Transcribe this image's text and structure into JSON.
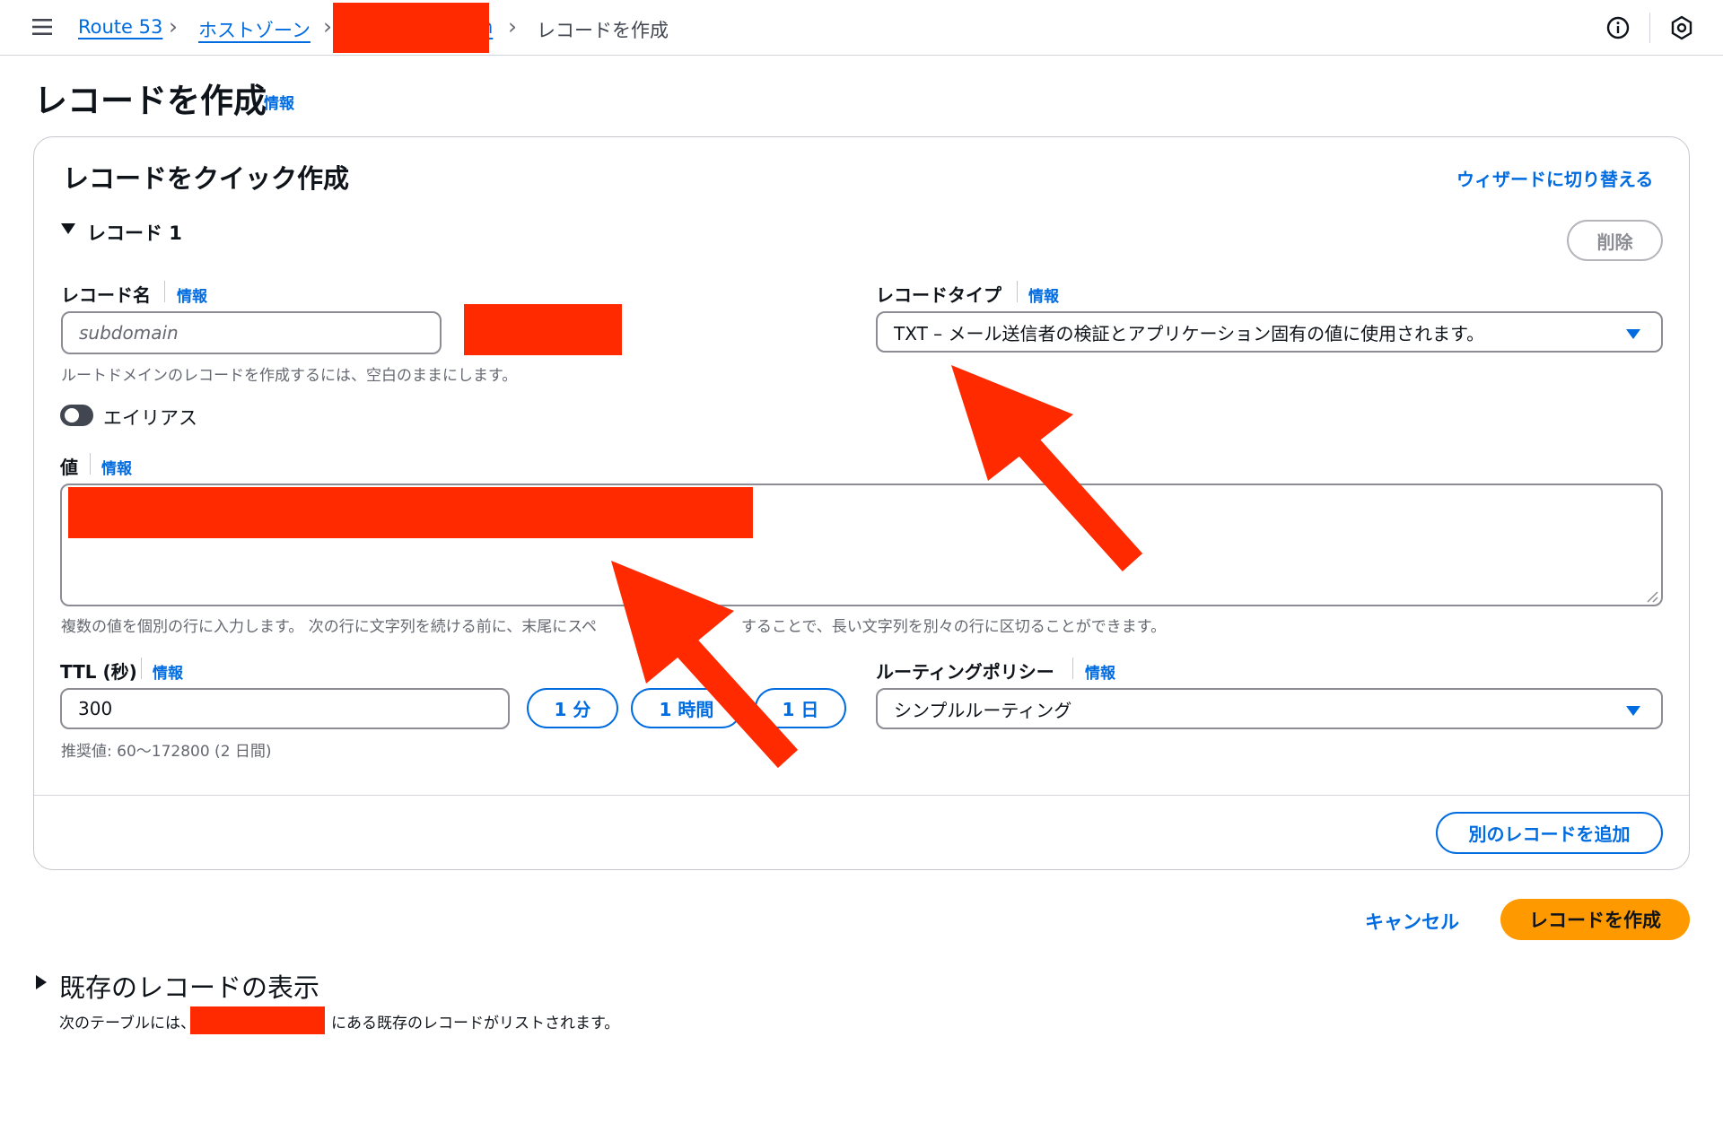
{
  "breadcrumb": {
    "route53": "Route 53",
    "hosted_zones": "ホストゾーン",
    "zone_fragment": "n",
    "current": "レコードを作成"
  },
  "page": {
    "title": "レコードを作成",
    "info": "情報"
  },
  "quick_create": {
    "title": "レコードをクイック作成",
    "switch_wizard": "ウィザードに切り替える",
    "record_section": "レコード 1",
    "delete": "削除",
    "record_name": {
      "label": "レコード名",
      "info": "情報",
      "placeholder": "subdomain",
      "hint": "ルートドメインのレコードを作成するには、空白のままにします。"
    },
    "record_type": {
      "label": "レコードタイプ",
      "info": "情報",
      "value": "TXT – メール送信者の検証とアプリケーション固有の値に使用されます。"
    },
    "alias": {
      "label": "エイリアス",
      "enabled": false
    },
    "value": {
      "label": "値",
      "info": "情報",
      "hint_before": "複数の値を個別の行に入力します。 次の行に文字列を続ける前に、末尾にスペ",
      "hint_after": "することで、長い文字列を別々の行に区切ることができます。"
    },
    "ttl": {
      "label": "TTL (秒)",
      "info": "情報",
      "value": "300",
      "btn_1min": "1 分",
      "btn_1hour": "1 時間",
      "btn_1day": "1 日",
      "hint": "推奨値: 60〜172800 (2 日間)"
    },
    "routing": {
      "label": "ルーティングポリシー",
      "info": "情報",
      "value": "シンプルルーティング"
    },
    "add_record": "別のレコードを追加"
  },
  "actions": {
    "cancel": "キャンセル",
    "create": "レコードを作成"
  },
  "existing": {
    "title": "既存のレコードの表示",
    "desc_before": "次のテーブルには、",
    "desc_after": "にある既存のレコードがリストされます。"
  },
  "colors": {
    "link": "#006ce0",
    "primary_button": "#ff9900",
    "annotation_red": "#ff2a00"
  }
}
